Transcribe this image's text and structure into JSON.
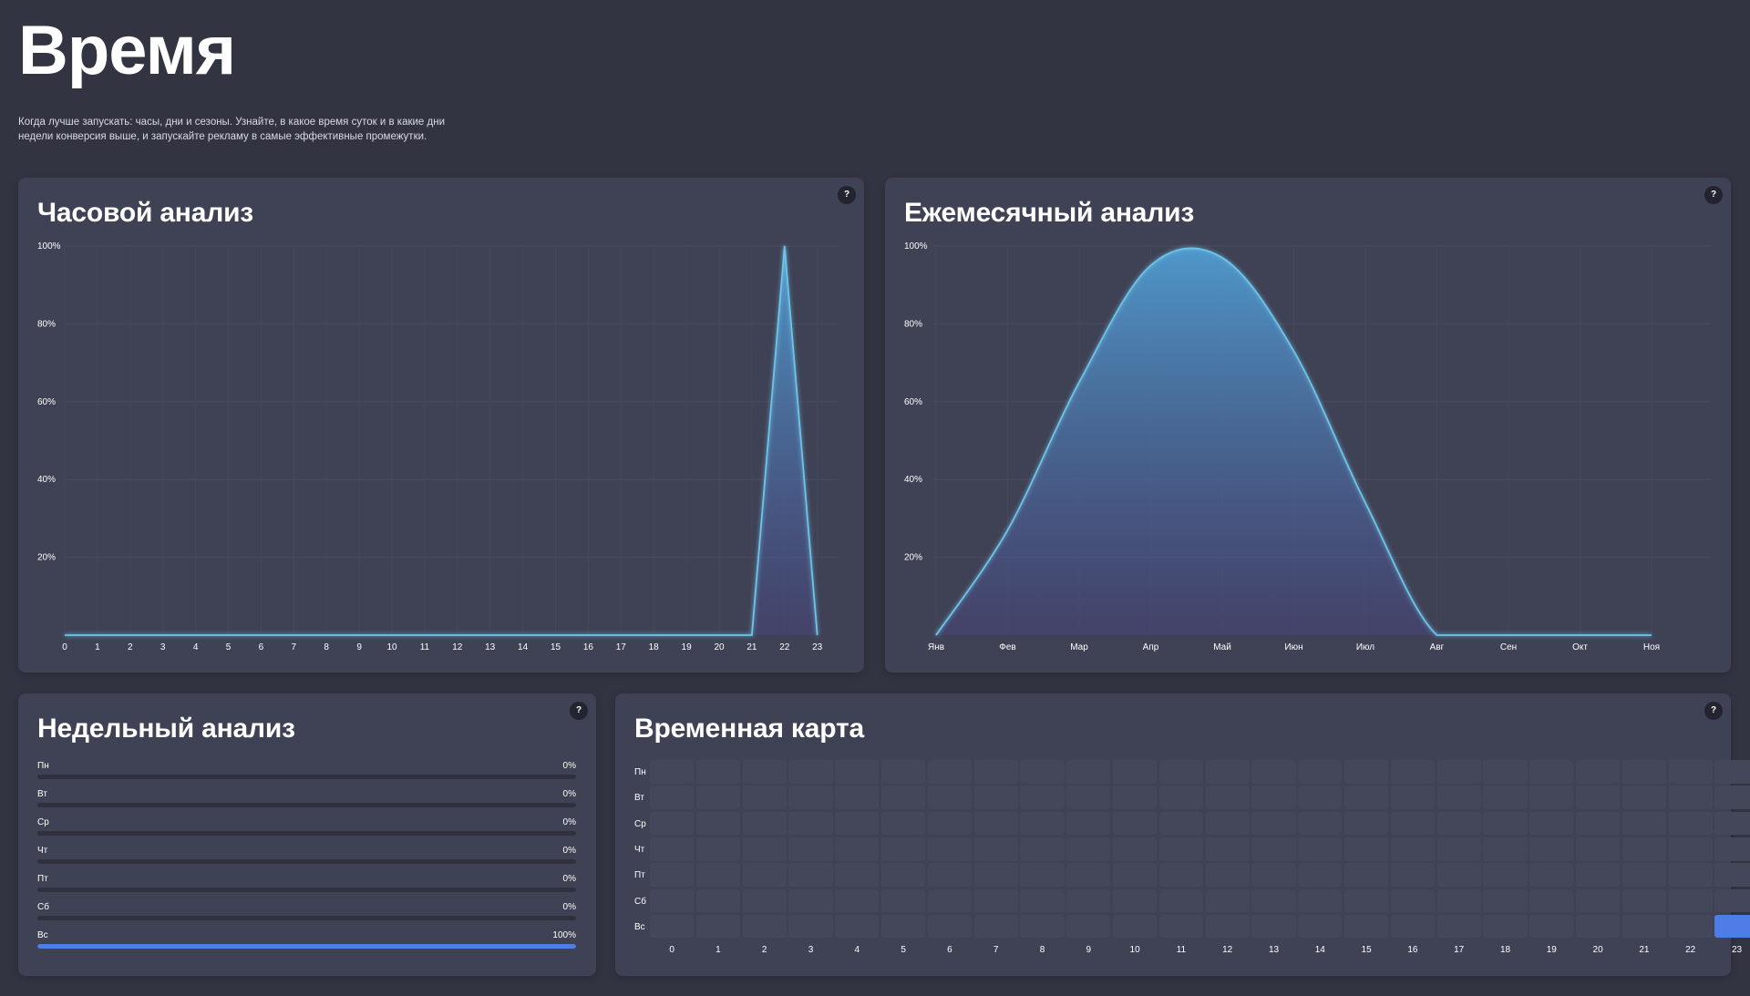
{
  "header": {
    "title": "Время",
    "description": "Когда лучше запускать: часы, дни и сезоны. Узнайте, в какое время суток и в какие дни недели конверсия выше, и запускайте рекламу в самые эффективные промежутки."
  },
  "colors": {
    "background": "#323442",
    "card": "#3f4154",
    "line": "#6ec3e8",
    "accent": "#4f7de8"
  },
  "help_icon": "?",
  "cards": {
    "hourly": {
      "title": "Часовой анализ"
    },
    "monthly": {
      "title": "Ежемесячный анализ"
    },
    "weekly": {
      "title": "Недельный анализ"
    },
    "heatmap": {
      "title": "Временная карта"
    }
  },
  "chart_data": [
    {
      "type": "area",
      "title": "Часовой анализ",
      "x": [
        "0",
        "1",
        "2",
        "3",
        "4",
        "5",
        "6",
        "7",
        "8",
        "9",
        "10",
        "11",
        "12",
        "13",
        "14",
        "15",
        "16",
        "17",
        "18",
        "19",
        "20",
        "21",
        "22",
        "23"
      ],
      "values": [
        0,
        0,
        0,
        0,
        0,
        0,
        0,
        0,
        0,
        0,
        0,
        0,
        0,
        0,
        0,
        0,
        0,
        0,
        0,
        0,
        0,
        0,
        100,
        0
      ],
      "yticks": [
        "20%",
        "40%",
        "60%",
        "80%",
        "100%"
      ],
      "ylim": [
        0,
        100
      ],
      "grid": true
    },
    {
      "type": "area",
      "title": "Ежемесячный анализ",
      "x": [
        "Янв",
        "Фев",
        "Мар",
        "Апр",
        "Май",
        "Июн",
        "Июл",
        "Авг",
        "Сен",
        "Окт",
        "Ноя"
      ],
      "values": [
        0,
        27,
        65,
        95,
        97,
        73,
        34,
        0,
        0,
        0,
        0
      ],
      "yticks": [
        "20%",
        "40%",
        "60%",
        "80%",
        "100%"
      ],
      "ylim": [
        0,
        100
      ],
      "grid": true
    },
    {
      "type": "bar",
      "title": "Недельный анализ",
      "categories": [
        "Пн",
        "Вт",
        "Ср",
        "Чт",
        "Пт",
        "Сб",
        "Вс"
      ],
      "values": [
        0,
        0,
        0,
        0,
        0,
        0,
        100
      ],
      "labels": [
        "0%",
        "0%",
        "0%",
        "0%",
        "0%",
        "0%",
        "100%"
      ]
    },
    {
      "type": "heatmap",
      "title": "Временная карта",
      "rows": [
        "Пн",
        "Вт",
        "Ср",
        "Чт",
        "Пт",
        "Сб",
        "Вс"
      ],
      "columns": [
        "0",
        "1",
        "2",
        "3",
        "4",
        "5",
        "6",
        "7",
        "8",
        "9",
        "10",
        "11",
        "12",
        "13",
        "14",
        "15",
        "16",
        "17",
        "18",
        "19",
        "20",
        "21",
        "22",
        "23"
      ],
      "active": [
        {
          "row": "Вс",
          "column": "23",
          "value": 100
        }
      ]
    }
  ]
}
